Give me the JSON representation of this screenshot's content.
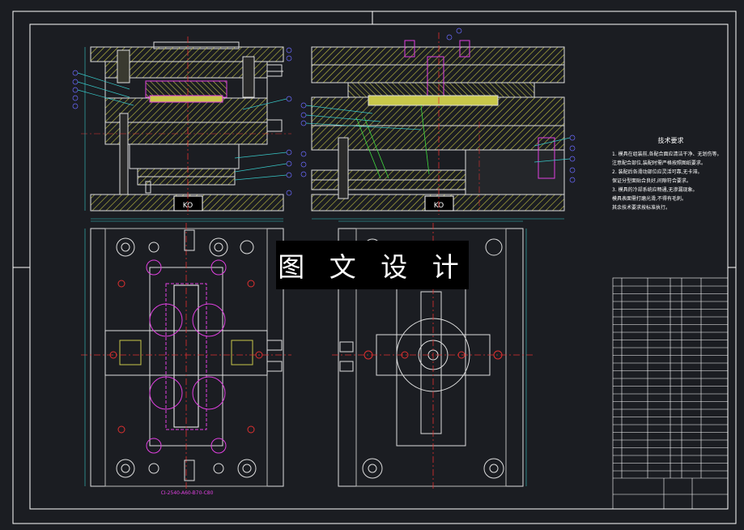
{
  "watermark": "图 文 设 计",
  "technical_requirements": {
    "title": "技术要求",
    "lines": [
      "1. 模具在组装前,各配合面应清洁干净、无划伤等。",
      "注意配合部位,装配时需严格按照图纸要求。",
      "2. 装配后各滑动部位应灵活可靠,无卡滞。",
      "保证分型面贴合良好,间隙符合要求。",
      "3. 模具的冷却系统应畅通,无渗漏现象。",
      "模具表面需打磨光滑,不得有毛刺。",
      "其余技术要求按标准执行。"
    ]
  },
  "front_view_label": "KO",
  "side_view_label": "KO",
  "bottom_caption": "CI-2540-A60-B70-C80",
  "colors": {
    "background": "#1b1d22",
    "frame": "#ffffff",
    "hatch": "#c8c84a",
    "centerline": "#e03030",
    "dimension": "#38c8c8",
    "balloon": "#6a6aff",
    "accent_magenta": "#e040e0",
    "accent_green": "#40e040"
  }
}
